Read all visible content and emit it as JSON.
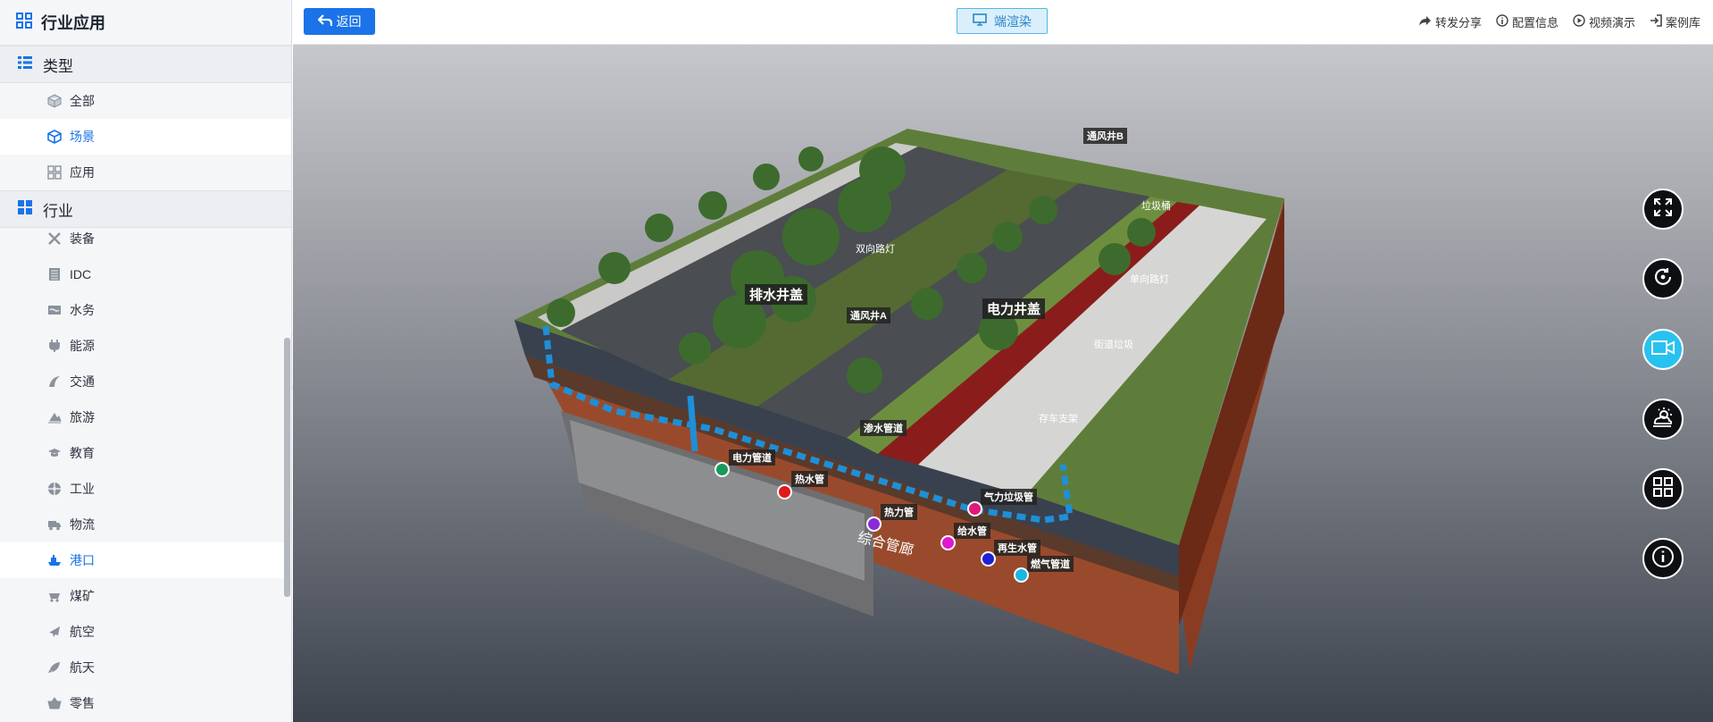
{
  "sidebar": {
    "title": "行业应用",
    "type_section": {
      "label": "类型",
      "items": [
        {
          "label": "全部",
          "icon": "cube-outline-icon",
          "active": false
        },
        {
          "label": "场景",
          "icon": "cube-icon",
          "active": true
        },
        {
          "label": "应用",
          "icon": "grid-apps-icon",
          "active": false
        }
      ]
    },
    "industry_section": {
      "label": "行业",
      "items": [
        {
          "label": "装备",
          "icon": "tools-icon"
        },
        {
          "label": "IDC",
          "icon": "server-rack-icon"
        },
        {
          "label": "水务",
          "icon": "water-icon"
        },
        {
          "label": "能源",
          "icon": "plug-icon"
        },
        {
          "label": "交通",
          "icon": "traffic-icon"
        },
        {
          "label": "旅游",
          "icon": "travel-icon"
        },
        {
          "label": "教育",
          "icon": "graduation-cap-icon"
        },
        {
          "label": "工业",
          "icon": "industry-icon"
        },
        {
          "label": "物流",
          "icon": "truck-icon"
        },
        {
          "label": "港口",
          "icon": "ship-icon"
        },
        {
          "label": "煤矿",
          "icon": "mining-cart-icon"
        },
        {
          "label": "航空",
          "icon": "airplane-icon"
        },
        {
          "label": "航天",
          "icon": "rocket-icon"
        },
        {
          "label": "零售",
          "icon": "basket-icon"
        }
      ],
      "active_label": "港口"
    }
  },
  "topbar": {
    "back_label": "返回",
    "render_label": "端渲染",
    "links": [
      {
        "label": "转发分享",
        "icon": "share-icon"
      },
      {
        "label": "配置信息",
        "icon": "info-icon"
      },
      {
        "label": "视频演示",
        "icon": "play-icon"
      },
      {
        "label": "案例库",
        "icon": "login-icon"
      }
    ]
  },
  "scene": {
    "labels": {
      "vent_b": "通风井B",
      "trash": "垃圾桶",
      "dual_lamp": "双向路灯",
      "drain_cover": "排水井盖",
      "vent_a": "通风井A",
      "power_cover": "电力井盖",
      "single_lamp": "单向路灯",
      "street_trash": "街道垃圾",
      "bike_rack": "存车支架",
      "seepage_pipe": "渗水管道",
      "power_pipe": "电力管道",
      "hot_water_pipe": "热水管",
      "heat_pipe": "热力管",
      "gas_garbage_pipe": "气力垃圾管",
      "water_supply_pipe": "给水管",
      "recycled_water_pipe": "再生水管",
      "gas_pipe": "燃气管道",
      "utility_tunnel": "综合管廊"
    }
  },
  "right_toolbar": [
    {
      "name": "fullscreen",
      "icon": "expand-arrows-icon"
    },
    {
      "name": "reset-view",
      "icon": "rotate-icon"
    },
    {
      "name": "record",
      "icon": "video-camera-icon",
      "active": true
    },
    {
      "name": "weather",
      "icon": "weather-icon"
    },
    {
      "name": "layout",
      "icon": "grid-layout-icon"
    },
    {
      "name": "info",
      "icon": "info-circle-icon"
    }
  ],
  "colors": {
    "accent": "#1a73e8",
    "render_bg": "#d9effb",
    "active_tool": "#27c2f0"
  }
}
